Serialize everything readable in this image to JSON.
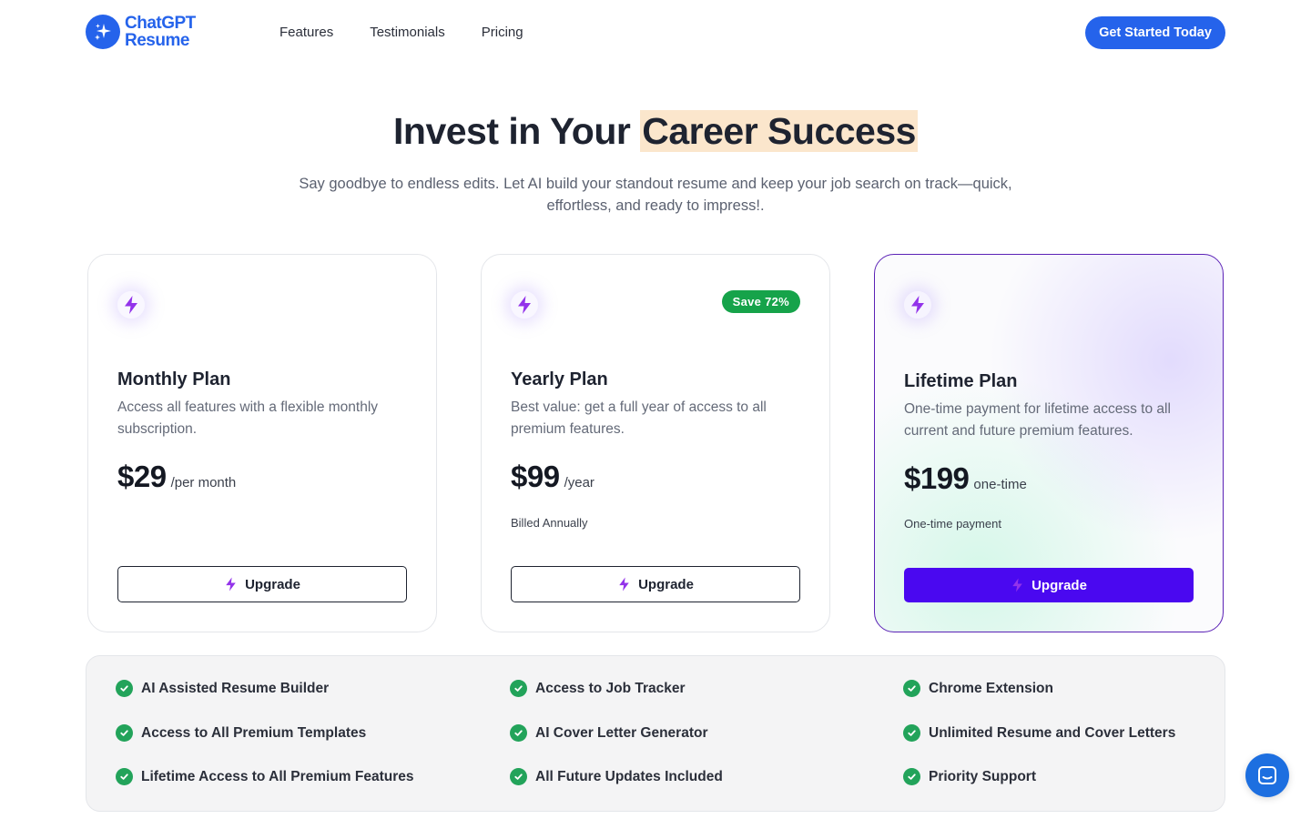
{
  "brand": {
    "line1": "ChatGPT",
    "line2": "Resume",
    "color": "#2563eb"
  },
  "nav": {
    "items": [
      "Features",
      "Testimonials",
      "Pricing"
    ],
    "cta_label": "Get Started Today"
  },
  "hero": {
    "title_plain": "Invest in Your ",
    "title_highlight": "Career Success",
    "subtitle": "Say goodbye to endless edits. Let AI build your standout resume and keep your job search on track—quick, effortless, and ready to impress!."
  },
  "plans": [
    {
      "name": "Monthly Plan",
      "description": "Access all features with a flexible monthly subscription.",
      "price": "$29",
      "period": "/per month",
      "billing_note": "",
      "badge": "",
      "button_label": "Upgrade",
      "icon": "bolt-icon"
    },
    {
      "name": "Yearly Plan",
      "description": "Best value: get a full year of access to all premium features.",
      "price": "$99",
      "period": "/year",
      "billing_note": "Billed Annually",
      "badge": "Save 72%",
      "button_label": "Upgrade",
      "icon": "bolt-icon"
    },
    {
      "name": "Lifetime Plan",
      "description": "One-time payment for lifetime access to all current and future premium features.",
      "price": "$199",
      "period": "one-time",
      "billing_note": "One-time payment",
      "badge": "",
      "button_label": "Upgrade",
      "icon": "bolt-icon"
    }
  ],
  "features": [
    "AI Assisted Resume Builder",
    "Access to Job Tracker",
    "Chrome Extension",
    "Access to All Premium Templates",
    "AI Cover Letter Generator",
    "Unlimited Resume and Cover Letters",
    "Lifetime Access to All Premium Features",
    "All Future Updates Included",
    "Priority Support"
  ],
  "colors": {
    "accent": "#2563eb",
    "bolt": "#9333ea",
    "primary_button": "#4a08f0",
    "badge": "#16a34a",
    "check": "#22a35a",
    "highlight": "#fbe6cc"
  },
  "chat": {
    "icon": "chat-icon"
  }
}
